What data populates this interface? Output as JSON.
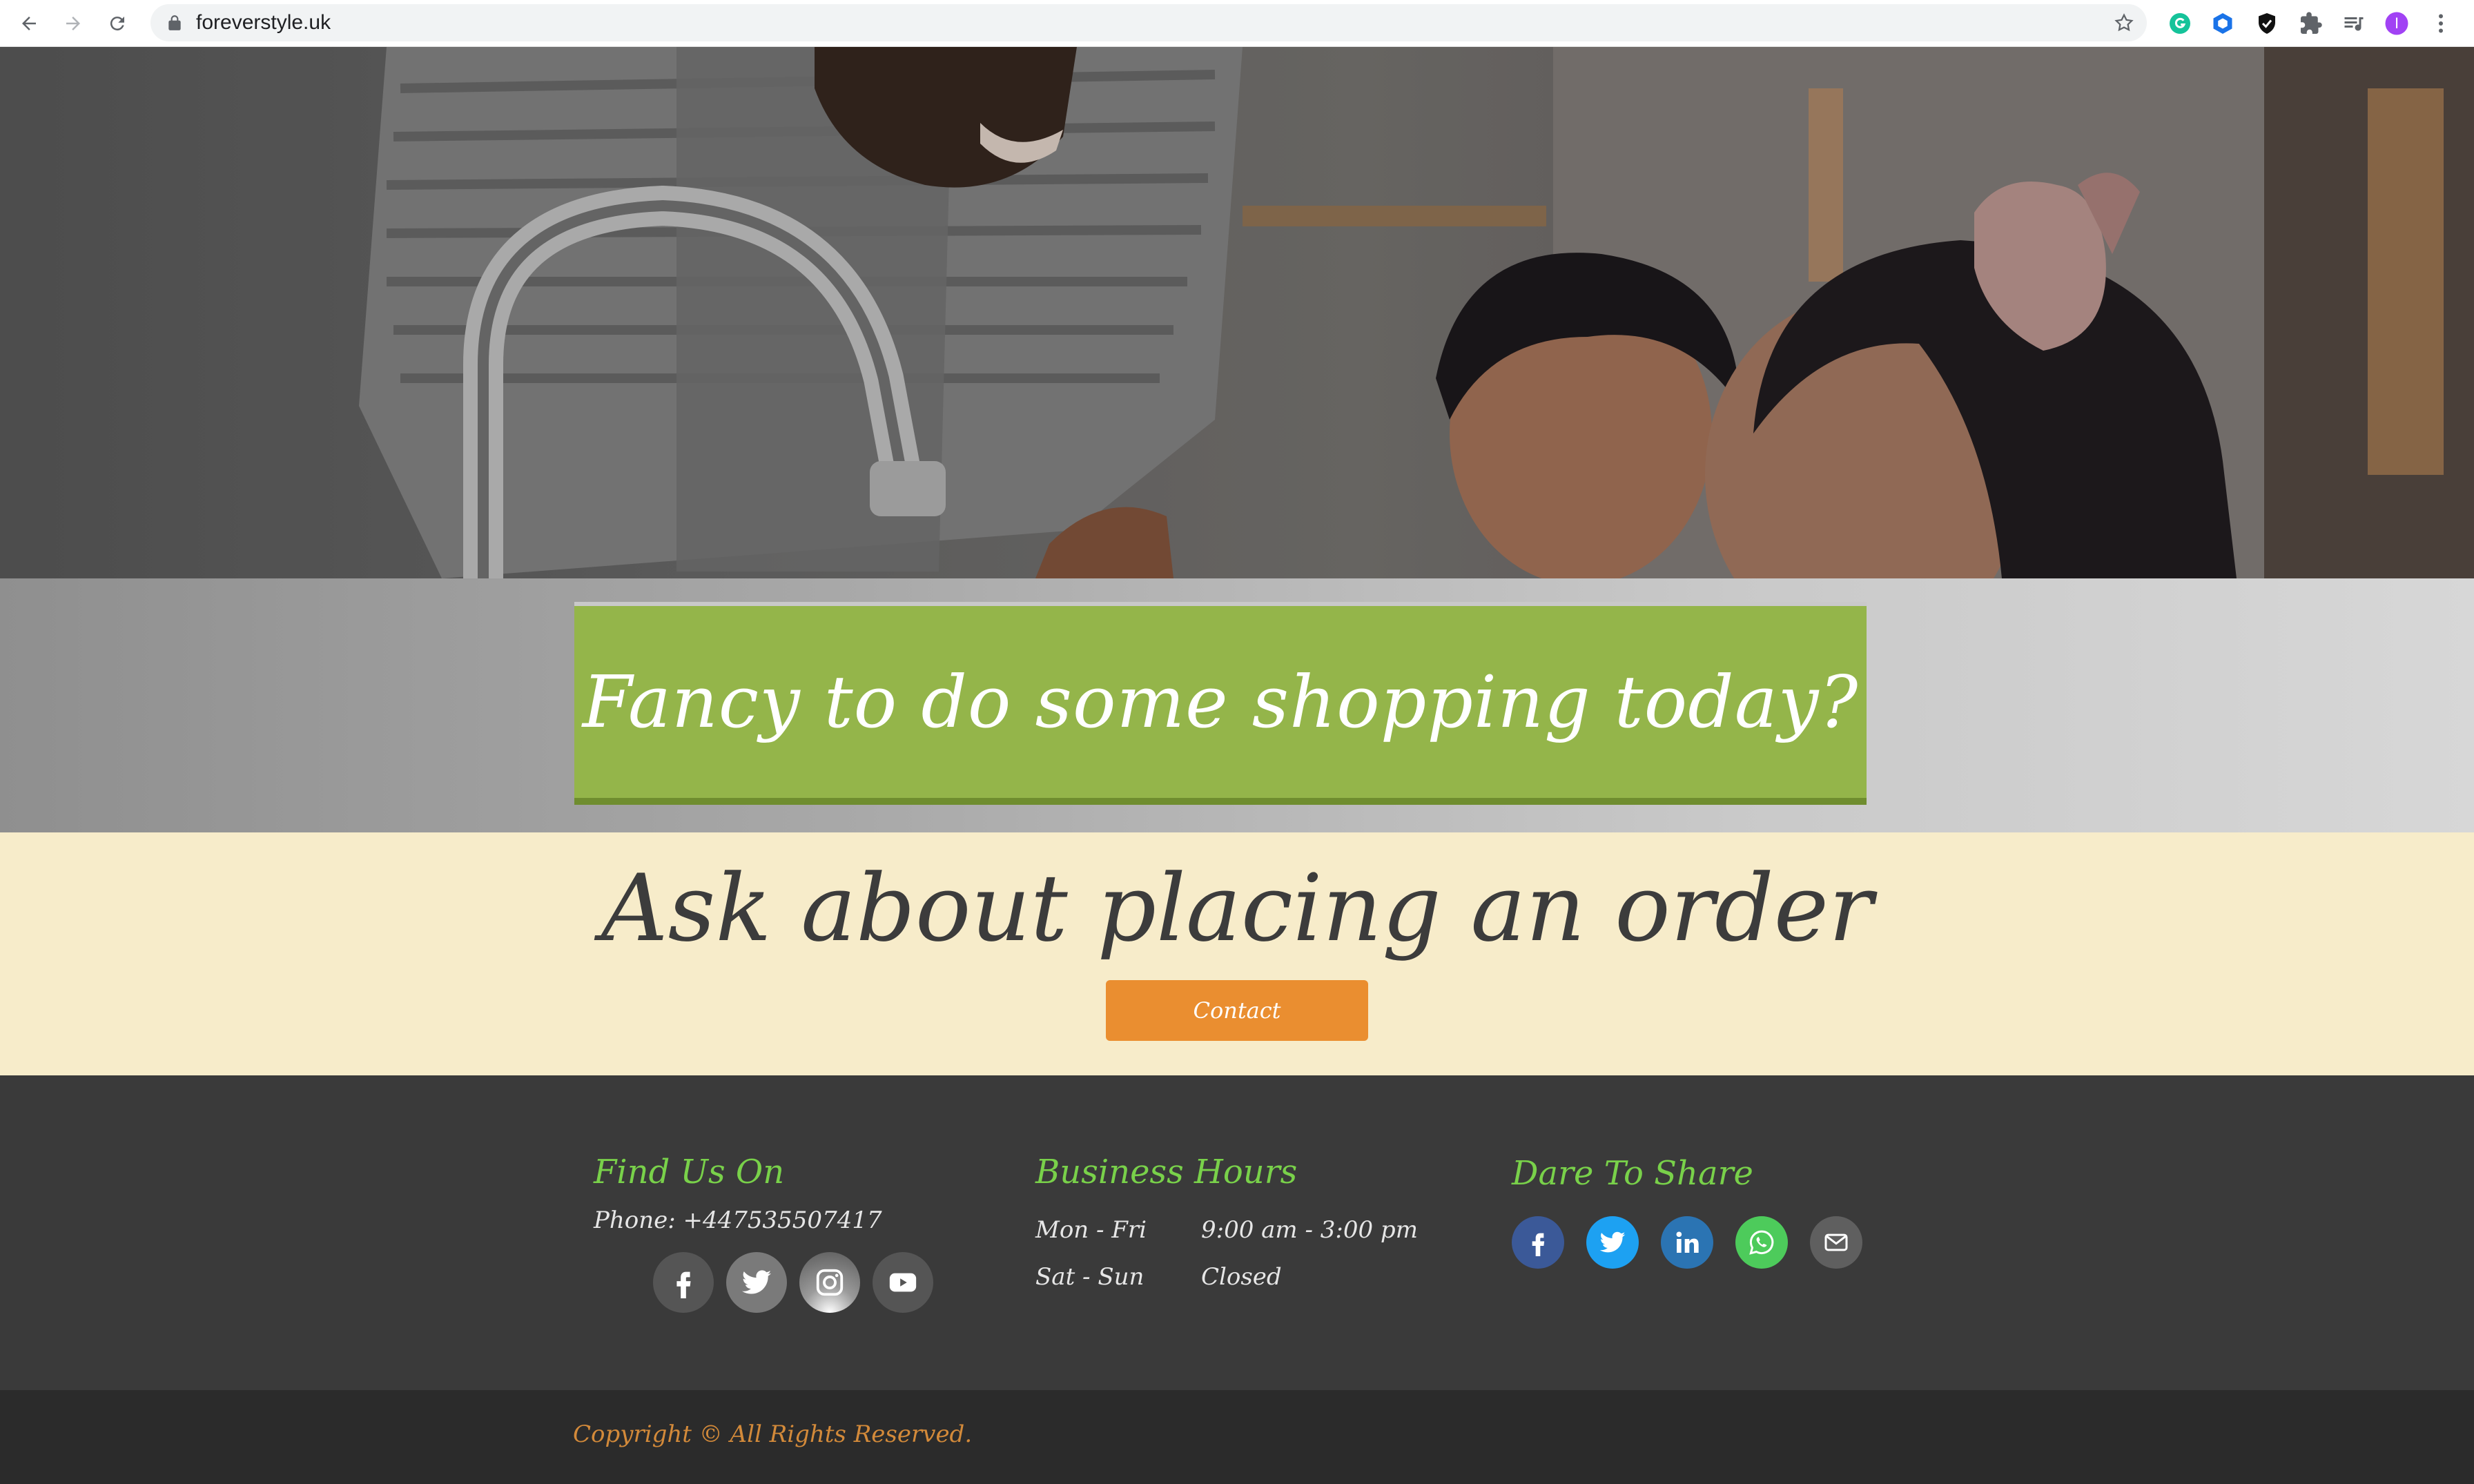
{
  "browser": {
    "url": "foreverstyle.uk",
    "profile_initial": "I"
  },
  "banner": {
    "title": "Fancy to do some shopping today?"
  },
  "order": {
    "title": "Ask about placing an order",
    "button_label": "Contact"
  },
  "footer": {
    "find_us": {
      "heading": "Find Us On",
      "phone": "Phone: +447535507417",
      "social": [
        "facebook-icon",
        "twitter-icon",
        "instagram-icon",
        "youtube-icon"
      ]
    },
    "hours": {
      "heading": "Business Hours",
      "rows": [
        {
          "days": "Mon - Fri",
          "time": "9:00 am - 3:00 pm"
        },
        {
          "days": "Sat - Sun",
          "time": "Closed"
        }
      ]
    },
    "share": {
      "heading": "Dare To Share",
      "icons": [
        "facebook-icon",
        "twitter-icon",
        "linkedin-icon",
        "whatsapp-icon",
        "mail-icon"
      ]
    },
    "copyright": "Copyright © All Rights Reserved."
  },
  "colors": {
    "banner_green": "#94b54a",
    "order_bg": "#f7ecca",
    "contact_orange": "#ea8e30",
    "footer_bg": "#3a3a3a",
    "footer_heading": "#79d14a",
    "copyright": "#d38a3a"
  }
}
